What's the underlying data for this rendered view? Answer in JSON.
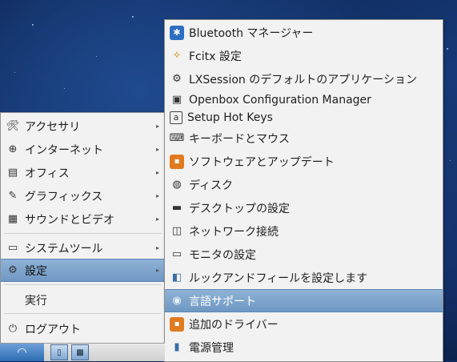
{
  "main_menu": {
    "items": [
      {
        "label": "アクセサリ",
        "icon": "accessories-icon",
        "glyph": "🛠"
      },
      {
        "label": "インターネット",
        "icon": "internet-icon",
        "glyph": "⊕"
      },
      {
        "label": "オフィス",
        "icon": "office-icon",
        "glyph": "▤"
      },
      {
        "label": "グラフィックス",
        "icon": "graphics-icon",
        "glyph": "✎"
      },
      {
        "label": "サウンドとビデオ",
        "icon": "sound-video-icon",
        "glyph": "▦"
      },
      {
        "label": "システムツール",
        "icon": "system-tools-icon",
        "glyph": "▭"
      },
      {
        "label": "設定",
        "icon": "settings-icon",
        "glyph": "⚙"
      },
      {
        "label": "実行",
        "icon": "",
        "glyph": ""
      },
      {
        "label": "ログアウト",
        "icon": "logout-icon",
        "glyph": "⏻"
      }
    ]
  },
  "settings_submenu": {
    "items": [
      {
        "label": "Bluetooth マネージャー",
        "icon": "bluetooth-icon",
        "glyph": "✱"
      },
      {
        "label": "Fcitx 設定",
        "icon": "fcitx-icon",
        "glyph": "✧"
      },
      {
        "label": "LXSession のデフォルトのアプリケーション",
        "icon": "gear-icon",
        "glyph": "⚙"
      },
      {
        "label": "Openbox Configuration Manager",
        "icon": "openbox-icon",
        "glyph": "▣"
      },
      {
        "label": "Setup Hot Keys",
        "icon": "hotkeys-icon",
        "glyph": "a"
      },
      {
        "label": "キーボードとマウス",
        "icon": "keyboard-icon",
        "glyph": "⌨"
      },
      {
        "label": "ソフトウェアとアップデート",
        "icon": "software-update-icon",
        "glyph": "▪"
      },
      {
        "label": "ディスク",
        "icon": "disk-icon",
        "glyph": "◍"
      },
      {
        "label": "デスクトップの設定",
        "icon": "desktop-settings-icon",
        "glyph": "▬"
      },
      {
        "label": "ネットワーク接続",
        "icon": "network-icon",
        "glyph": "◫"
      },
      {
        "label": "モニタの設定",
        "icon": "monitor-icon",
        "glyph": "▭"
      },
      {
        "label": "ルックアンドフィールを設定します",
        "icon": "appearance-icon",
        "glyph": "◧"
      },
      {
        "label": "言語サポート",
        "icon": "language-icon",
        "glyph": "◉"
      },
      {
        "label": "追加のドライバー",
        "icon": "drivers-icon",
        "glyph": "▪"
      },
      {
        "label": "電源管理",
        "icon": "power-icon",
        "glyph": "▮"
      }
    ]
  },
  "taskbar": {
    "start_glyph": "◠",
    "file_manager_glyph": "▯",
    "desktop_glyph": "▩"
  }
}
